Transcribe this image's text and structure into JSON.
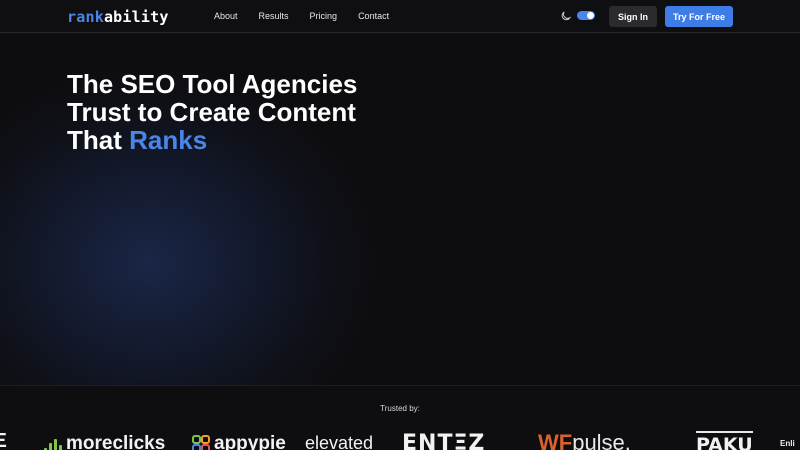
{
  "nav": {
    "logo_part1": "rank",
    "logo_part2": "ability",
    "links": [
      {
        "label": "About"
      },
      {
        "label": "Results"
      },
      {
        "label": "Pricing"
      },
      {
        "label": "Contact"
      }
    ],
    "theme_icon": "moon-icon",
    "sign_in_label": "Sign In",
    "try_label": "Try For Free"
  },
  "hero": {
    "title_line1": "The SEO Tool Agencies",
    "title_line2": "Trust to Create Content",
    "title_line3_plain": "That ",
    "title_line3_accent": "Ranks"
  },
  "trusted": {
    "label": "Trusted by:",
    "logos": {
      "partial_left": "Ξ",
      "moreclicks": "moreclicks",
      "appypie": "appypie",
      "elevated": "elevated",
      "entez": "ENTΞZ",
      "wp_wf": "WF",
      "wp_pulse": "pulse.",
      "paku": "PAKU",
      "edge": "Enli"
    }
  },
  "colors": {
    "accent": "#4a86e8",
    "button_primary": "#3f7de6",
    "button_secondary": "#2a2a2f",
    "moreclicks_green": "#7cc74a",
    "wp_orange": "#d9622b",
    "background": "#0d0d0f"
  }
}
